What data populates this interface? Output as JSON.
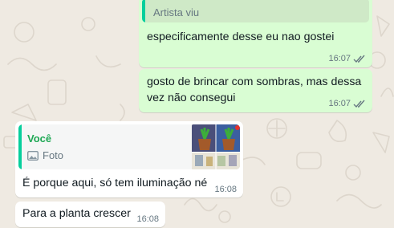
{
  "colors": {
    "chat_bg": "#efeae2",
    "outgoing_bubble": "#d9fdd3",
    "incoming_bubble": "#ffffff",
    "quote_bg_outgoing": "#cfe9c7",
    "quote_bar_green": "#06cf9c",
    "quote_bar_teal": "#53bdeb",
    "author_green": "#1fa855",
    "read_ticks": "#667781",
    "meta_text": "#667781"
  },
  "messages": [
    {
      "direction": "outgoing",
      "quote": {
        "author": "Artista viu"
      },
      "text": "especificamente desse eu nao gostei",
      "time": "16:07",
      "ticks_icon": "double-check-icon"
    },
    {
      "direction": "outgoing",
      "text": "gosto de brincar com sombras, mas dessa vez não consegui",
      "time": "16:07",
      "ticks_icon": "double-check-icon"
    },
    {
      "direction": "incoming",
      "quote": {
        "author": "Você",
        "media_label": "Foto",
        "media_icon": "photo-icon"
      },
      "text": "É porque aqui, só tem iluminação né",
      "time": "16:08"
    },
    {
      "direction": "incoming",
      "text": "Para a planta crescer",
      "time": "16:08"
    }
  ]
}
